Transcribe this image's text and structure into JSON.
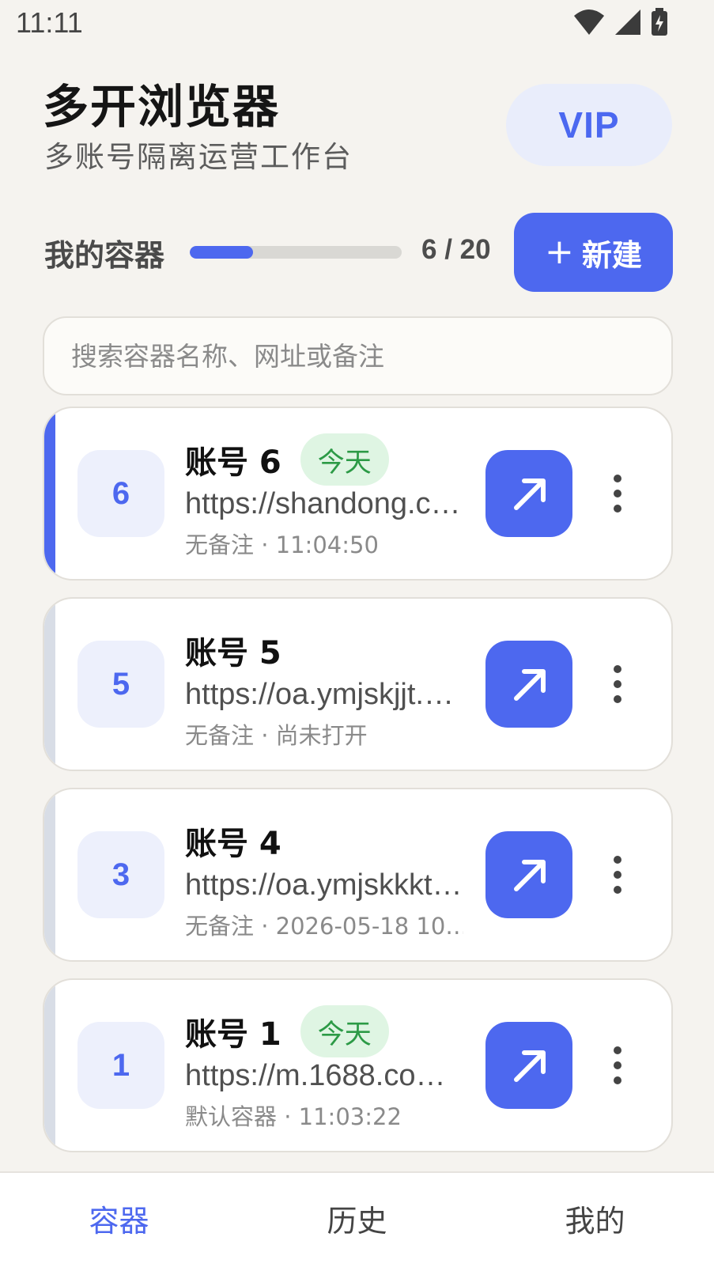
{
  "status_bar": {
    "time": "11:11",
    "icons": [
      "wifi-icon",
      "cell-signal-icon",
      "battery-charging-icon"
    ]
  },
  "header": {
    "title": "多开浏览器",
    "subtitle": "多账号隔离运营工作台",
    "vip_label": "VIP"
  },
  "containers": {
    "section_title": "我的容器",
    "used": 6,
    "limit": 20,
    "usage_fraction": 0.3,
    "count_label": "6 / 20",
    "new_button_label": "新建"
  },
  "search": {
    "placeholder": "搜索容器名称、网址或备注",
    "value": ""
  },
  "cards": [
    {
      "badge": "6",
      "title": "账号 6",
      "tag": "今天",
      "url": "https://shandong.c…",
      "meta": "无备注 · 11:04:50",
      "active": true
    },
    {
      "badge": "5",
      "title": "账号 5",
      "tag": "",
      "url": "https://oa.ymjskjjt.…",
      "meta": "无备注 · 尚未打开",
      "active": false
    },
    {
      "badge": "3",
      "title": "账号 4",
      "tag": "",
      "url": "https://oa.ymjskkkt…",
      "meta": "无备注 · 2026-05-18 10…",
      "active": false
    },
    {
      "badge": "1",
      "title": "账号 1",
      "tag": "今天",
      "url": "https://m.1688.co…",
      "meta": "默认容器 · 11:03:22",
      "active": false
    }
  ],
  "bottom_nav": {
    "tabs": [
      {
        "label": "容器",
        "active": true
      },
      {
        "label": "历史",
        "active": false
      },
      {
        "label": "我的",
        "active": false
      }
    ]
  },
  "colors": {
    "accent": "#4d68ef",
    "background": "#f5f3ef",
    "tag_green": "#2c9a46"
  }
}
